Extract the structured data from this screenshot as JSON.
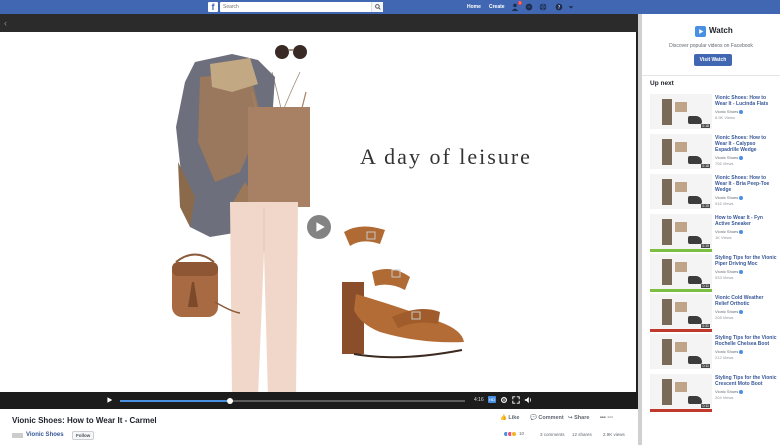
{
  "topbar": {
    "logo": "f",
    "search_placeholder": "Search",
    "nav": [
      "Home",
      "Create"
    ],
    "notification_count": "1"
  },
  "video": {
    "overlay_text": "A day of leisure",
    "time": "4:16",
    "hd": "HD",
    "progress": 0.32
  },
  "post": {
    "title": "Vionic Shoes: How to Wear It - Carmel",
    "page_name": "Vionic Shoes",
    "follow_label": "Follow",
    "actions": {
      "like": "Like",
      "comment": "Comment",
      "share": "Share"
    },
    "reactions_count": "10",
    "comments": "3 comments",
    "shares": "12 shares",
    "views": "2.9K views"
  },
  "sidebar": {
    "watch_title": "Watch",
    "watch_subtitle": "Discover popular videos on Facebook",
    "watch_button": "Visit Watch",
    "up_next_title": "Up next",
    "items": [
      {
        "title": "Vionic Shoes: How to Wear It - Lucinda Flats",
        "channel": "Vionic Shoes",
        "views": "6.9K Views",
        "duration": "0:18"
      },
      {
        "title": "Vionic Shoes: How to Wear It - Calypso Espadrille Wedge",
        "channel": "Vionic Shoes",
        "views": "706 Views",
        "duration": "0:18"
      },
      {
        "title": "Vionic Shoes: How to Wear It - Bria Peep-Toe Wedge",
        "channel": "Vionic Shoes",
        "views": "916 Views",
        "duration": "0:15"
      },
      {
        "title": "How to Wear It - Fyn Active Sneaker",
        "channel": "Vionic Shoes",
        "views": "1K Views",
        "duration": "0:19"
      },
      {
        "title": "Styling Tips for the Vionic Piper Driving Moc",
        "channel": "Vionic Shoes",
        "views": "533 Views",
        "duration": "0:11"
      },
      {
        "title": "Vionic Cold Weather Relief Orthotic",
        "channel": "Vionic Shoes",
        "views": "208 Views",
        "duration": "0:31"
      },
      {
        "title": "Styling Tips for the Vionic Rochelle Chelsea Boot",
        "channel": "Vionic Shoes",
        "views": "212 Views",
        "duration": "0:11"
      },
      {
        "title": "Styling Tips for the Vionic Crescent Moto Boot",
        "channel": "Vionic Shoes",
        "views": "204 Views",
        "duration": "0:11"
      }
    ],
    "thumb_bar_colors": [
      "#ffffff",
      "#ffffff",
      "#ffffff",
      "#7bc043",
      "#7bc043",
      "#c0392b",
      "#ffffff",
      "#c0392b"
    ]
  },
  "colors": {
    "brand": "#4267b2",
    "link": "#385898",
    "accent": "#4a90e2"
  }
}
